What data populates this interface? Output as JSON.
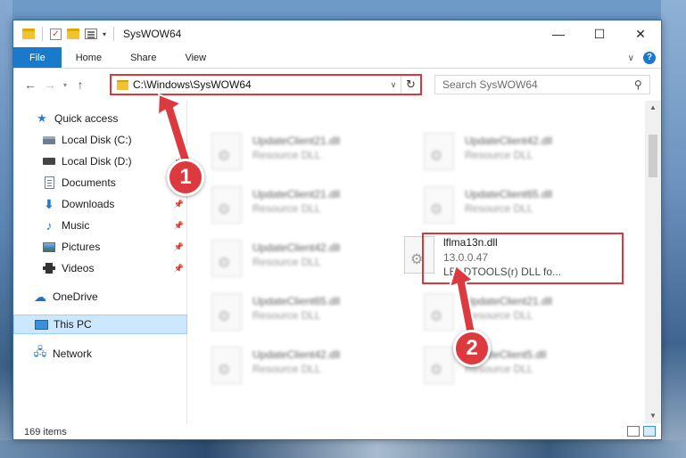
{
  "window": {
    "title": "SysWOW64",
    "controls": {
      "minimize": "—",
      "maximize": "☐",
      "close": "✕"
    }
  },
  "ribbon": {
    "tabs": [
      {
        "label": "File"
      },
      {
        "label": "Home"
      },
      {
        "label": "Share"
      },
      {
        "label": "View"
      }
    ],
    "help": "?"
  },
  "address": {
    "path": "C:\\Windows\\SysWOW64",
    "refresh": "↻"
  },
  "search": {
    "placeholder": "Search SysWOW64",
    "icon": "⚲"
  },
  "sidebar": {
    "items": [
      {
        "label": "Quick access"
      },
      {
        "label": "Local Disk (C:)"
      },
      {
        "label": "Local Disk (D:)"
      },
      {
        "label": "Documents"
      },
      {
        "label": "Downloads"
      },
      {
        "label": "Music"
      },
      {
        "label": "Pictures"
      },
      {
        "label": "Videos"
      },
      {
        "label": "OneDrive"
      },
      {
        "label": "This PC"
      },
      {
        "label": "Network"
      }
    ]
  },
  "files": [
    {
      "name": "UpdateClient21.dll",
      "type": "Resource DLL"
    },
    {
      "name": "UpdateClient42.dll",
      "type": "Resource DLL"
    },
    {
      "name": "UpdateClient21.dll",
      "type": "Resource DLL"
    },
    {
      "name": "UpdateClient65.dll",
      "type": "Resource DLL"
    },
    {
      "name": "UpdateClient42.dll",
      "type": "Resource DLL"
    },
    {
      "name": "lflma13n.dll",
      "version": "13.0.0.47",
      "description": "LEADTOOLS(r) DLL fo..."
    },
    {
      "name": "UpdateClient65.dll",
      "type": "Resource DLL"
    },
    {
      "name": "UpdateClient21.dll",
      "type": "Resource DLL"
    },
    {
      "name": "UpdateClient42.dll",
      "type": "Resource DLL"
    },
    {
      "name": "UpdateClient5.dll",
      "type": "Resource DLL"
    }
  ],
  "status": {
    "items_count": "169 items"
  },
  "annotations": {
    "step1": "1",
    "step2": "2",
    "color": "#dc3a3e"
  }
}
